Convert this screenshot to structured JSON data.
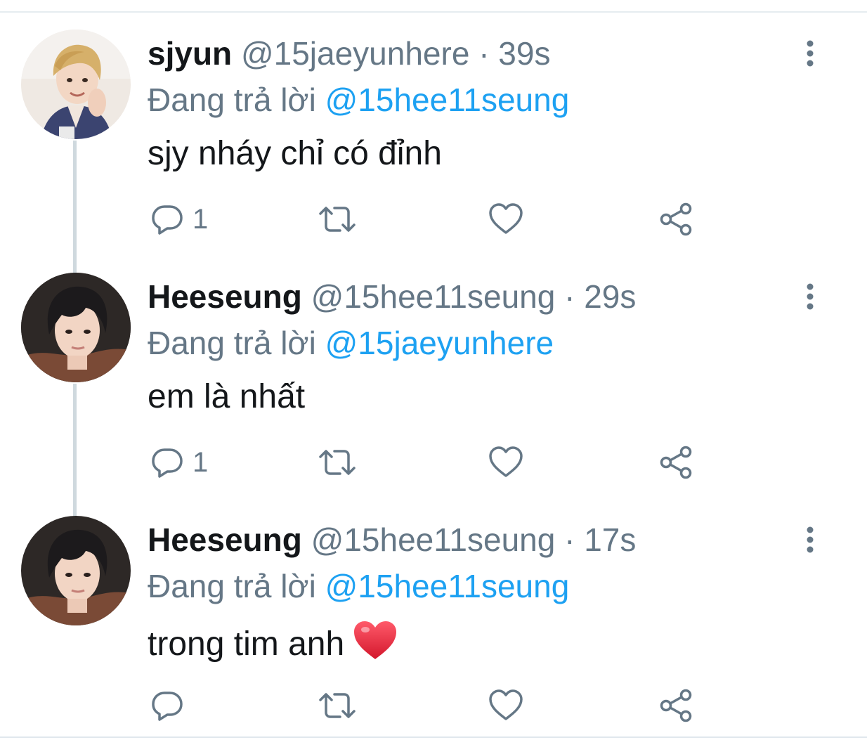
{
  "thread": {
    "tweets": [
      {
        "display_name": "sjyun",
        "handle": "@15jaeyunhere",
        "time": " · 39s",
        "reply_prefix": "Đang trả lời ",
        "reply_to": "@15hee11seung",
        "text": "sjy nháy chỉ có đỉnh",
        "reply_count": "1",
        "avatar_icon": "profile-photo-blond"
      },
      {
        "display_name": "Heeseung",
        "handle": "@15hee11seung",
        "time": " · 29s",
        "reply_prefix": "Đang trả lời ",
        "reply_to": "@15jaeyunhere",
        "text": "em là nhất",
        "reply_count": "1",
        "avatar_icon": "profile-photo-dark-hair"
      },
      {
        "display_name": "Heeseung",
        "handle": "@15hee11seung",
        "time": " · 17s",
        "reply_prefix": "Đang trả lời ",
        "reply_to": "@15hee11seung",
        "text": "trong tim anh",
        "reply_count": "",
        "avatar_icon": "profile-photo-dark-hair",
        "emoji": "red-heart-emoji"
      }
    ]
  },
  "colors": {
    "text_primary": "#14171a",
    "text_secondary": "#657786",
    "mention": "#1da1f2",
    "thread_line": "#cfd9de",
    "heart_emoji": "#e0243a"
  },
  "icons": {
    "reply": "reply-icon",
    "retweet": "retweet-icon",
    "like": "like-icon",
    "share": "share-icon",
    "more": "more-vertical-icon"
  }
}
